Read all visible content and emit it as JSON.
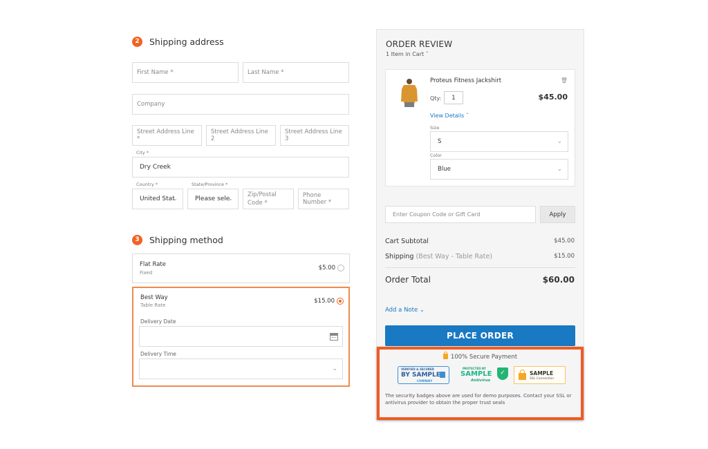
{
  "shipping_address": {
    "step_number": "2",
    "title": "Shipping address",
    "fields": {
      "first_name": {
        "placeholder": "First Name *",
        "value": ""
      },
      "last_name": {
        "placeholder": "Last Name *",
        "value": ""
      },
      "company": {
        "placeholder": "Company",
        "value": ""
      },
      "street1": {
        "placeholder": "Street Address Line *",
        "value": ""
      },
      "street2": {
        "placeholder": "Street Address Line 2",
        "value": ""
      },
      "street3": {
        "placeholder": "Street Address Line 3",
        "value": ""
      },
      "city": {
        "label": "City *",
        "value": "Dry Creek"
      },
      "country": {
        "label": "Country *",
        "value": "United Stat"
      },
      "state": {
        "label": "State/Province *",
        "value": "Please sele"
      },
      "zip": {
        "placeholder": "Zip/Postal Code *",
        "value": ""
      },
      "phone": {
        "placeholder": "Phone Number *",
        "value": ""
      }
    }
  },
  "shipping_method": {
    "step_number": "3",
    "title": "Shipping method",
    "options": [
      {
        "name": "Flat Rate",
        "sub": "Fixed",
        "price": "$5.00",
        "selected": false
      },
      {
        "name": "Best Way",
        "sub": "Table Rate",
        "price": "$15.00",
        "selected": true
      }
    ],
    "delivery_date_label": "Delivery Date",
    "delivery_date_value": "",
    "delivery_time_label": "Delivery Time",
    "delivery_time_value": ""
  },
  "order_review": {
    "title": "ORDER REVIEW",
    "items_count": "1 Item in Cart",
    "item": {
      "name": "Proteus Fitness Jackshirt",
      "qty_label": "Qty:",
      "qty": "1",
      "price": "$45.00",
      "view_details": "View Details",
      "size_label": "Size",
      "size_value": "S",
      "color_label": "Color",
      "color_value": "Blue"
    },
    "coupon_placeholder": "Enter Coupon Code or Gift Card",
    "apply_label": "Apply",
    "subtotal_label": "Cart Subtotal",
    "subtotal_value": "$45.00",
    "shipping_label": "Shipping",
    "shipping_detail": "(Best Way - Table Rate)",
    "shipping_value": "$15.00",
    "total_label": "Order Total",
    "total_value": "$60.00",
    "add_note": "Add a Note",
    "place_order": "PLACE ORDER"
  },
  "secure": {
    "title": "100% Secure Payment",
    "badges": [
      {
        "line1": "VERIFIED & SECURED",
        "line2": "BY SAMPLE",
        "line3": "COMPANY"
      },
      {
        "line1": "PROTECTED BY",
        "line2": "SAMPLE",
        "line3": "Antivirus"
      },
      {
        "line2": "SAMPLE",
        "line3": "SSL Connection"
      }
    ],
    "disclaimer": "The security badges above are used for demo purposes. Contact your SSL or antivirus provider to obtain the proper trust seals"
  },
  "colors": {
    "accent": "#f26322",
    "primary_button": "#1979c3",
    "highlight_border": "#f15a22"
  }
}
